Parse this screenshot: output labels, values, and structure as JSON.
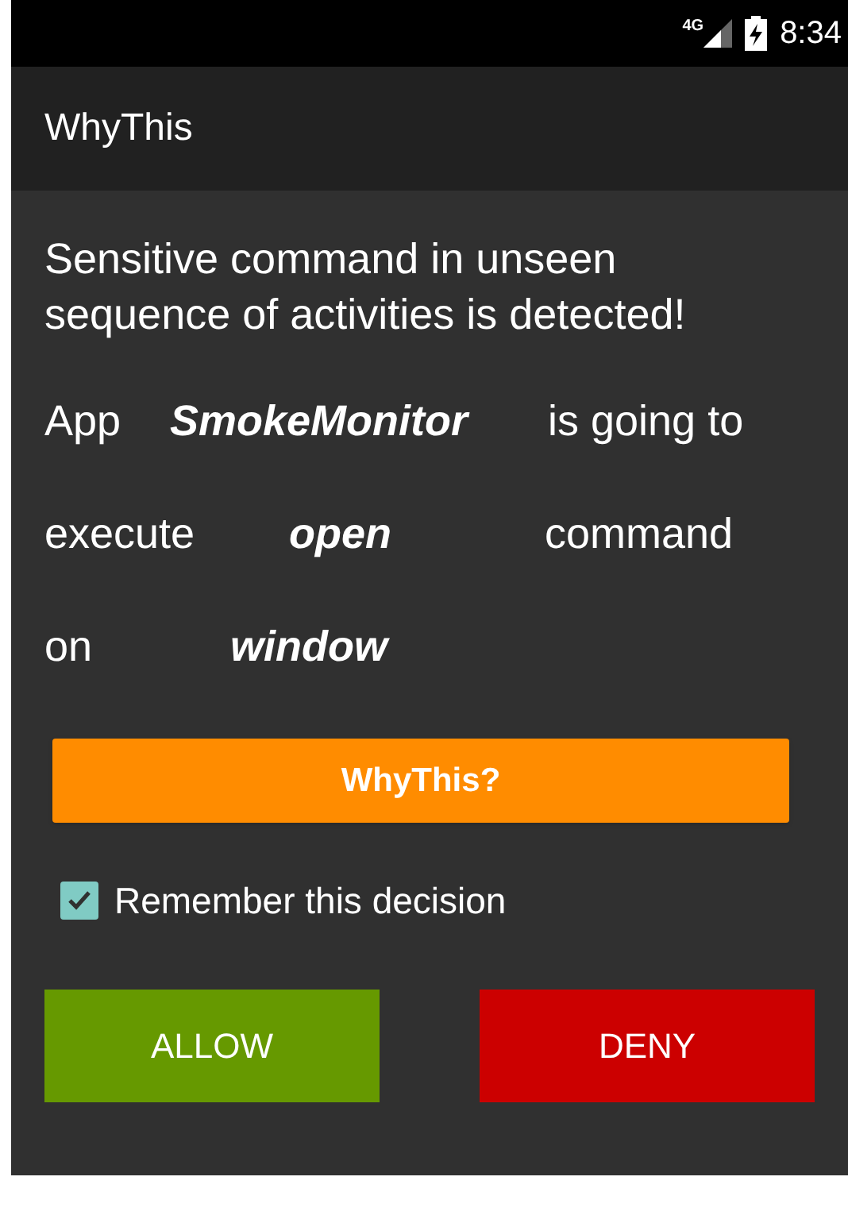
{
  "status_bar": {
    "network": "4G",
    "time": "8:34"
  },
  "app_bar": {
    "title": "WhyThis"
  },
  "message": "Sensitive command in unseen sequence of activities is detected!",
  "statement_rows": [
    {
      "label": "App",
      "value": "SmokeMonitor",
      "tail": "is going to"
    },
    {
      "label": "execute",
      "value": "open",
      "tail": "command"
    },
    {
      "label": "on",
      "value": "window"
    }
  ],
  "why_button": "WhyThis?",
  "remember": {
    "label": "Remember this decision",
    "checked": true
  },
  "actions": [
    {
      "label": "ALLOW",
      "kind": "allow"
    },
    {
      "label": "DENY",
      "kind": "deny"
    }
  ]
}
